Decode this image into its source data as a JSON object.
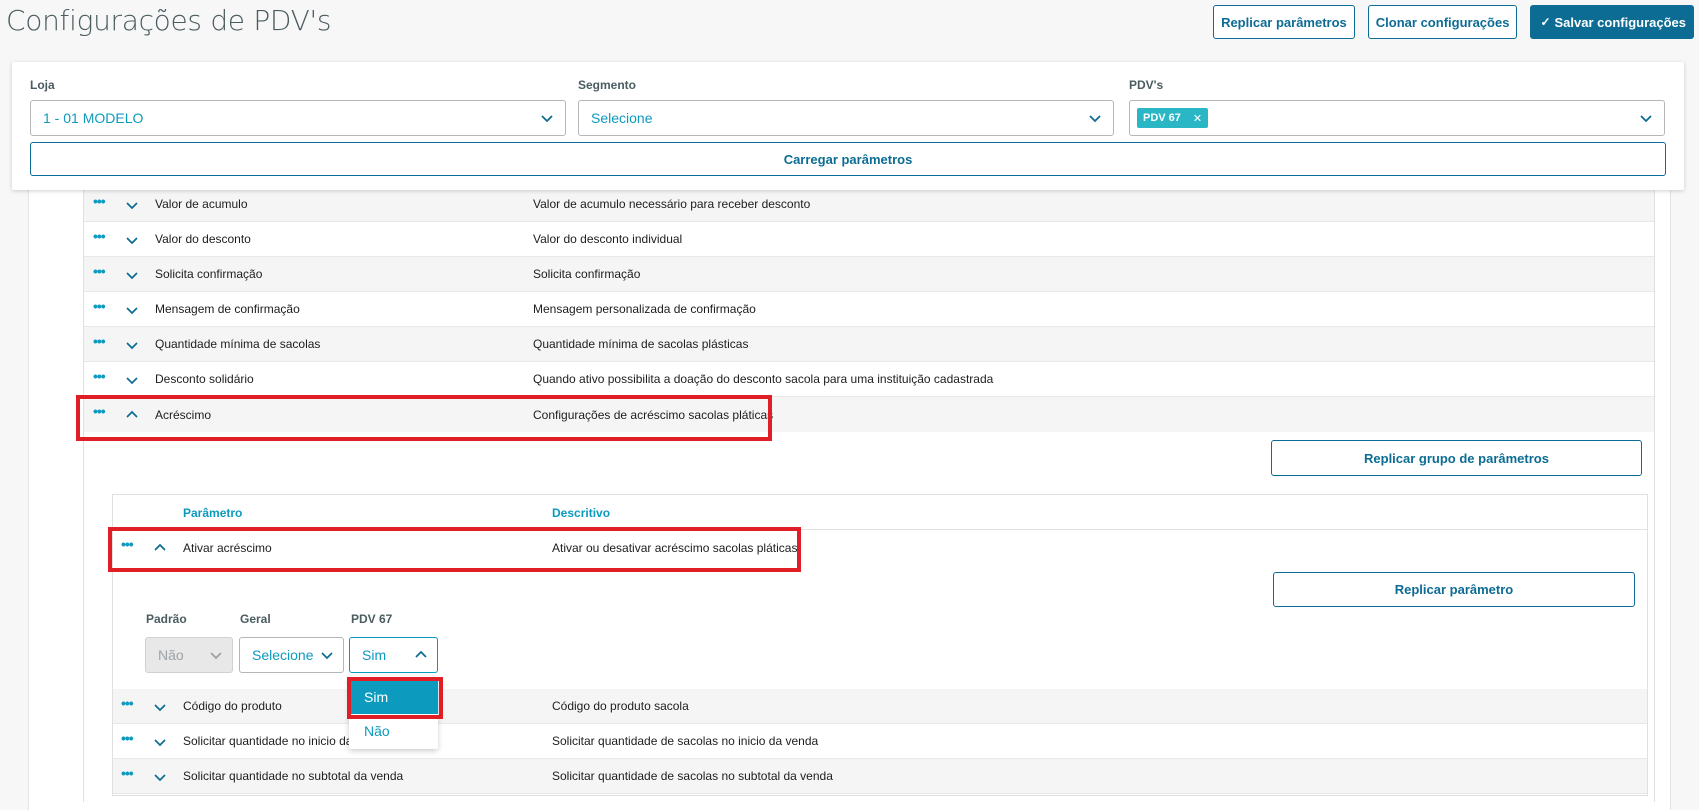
{
  "page": {
    "title": "Configurações de PDV's",
    "actions": {
      "replicate": "Replicar parâmetros",
      "clone": "Clonar configurações",
      "save": "Salvar configurações"
    }
  },
  "filters": {
    "loja": {
      "label": "Loja",
      "value": "1 - 01 MODELO"
    },
    "segmento": {
      "label": "Segmento",
      "value": "Selecione"
    },
    "pdvs": {
      "label": "PDV's",
      "tags": [
        "PDV 67"
      ]
    },
    "load_button": "Carregar parâmetros"
  },
  "outer_rows": [
    {
      "name": "Valor de acumulo",
      "desc": "Valor de acumulo necessário para receber desconto"
    },
    {
      "name": "Valor do desconto",
      "desc": "Valor do desconto individual"
    },
    {
      "name": "Solicita confirmação",
      "desc": "Solicita confirmação"
    },
    {
      "name": "Mensagem de confirmação",
      "desc": "Mensagem personalizada de confirmação"
    },
    {
      "name": "Quantidade mínima de sacolas",
      "desc": "Quantidade mínima de sacolas plásticas"
    },
    {
      "name": "Desconto solidário",
      "desc": "Quando ativo possibilita a doação do desconto sacola para uma instituição cadastrada"
    },
    {
      "name": "Acréscimo",
      "desc": "Configurações de acréscimo sacolas pláticas"
    }
  ],
  "group": {
    "replicate_group_button": "Replicar grupo de parâmetros",
    "headers": {
      "param": "Parâmetro",
      "desc": "Descritivo"
    },
    "expanded_row": {
      "name": "Ativar acréscimo",
      "desc": "Ativar ou desativar acréscimo sacolas pláticas"
    },
    "replicate_param_button": "Replicar parâmetro",
    "editor": {
      "padrao": {
        "label": "Padrão",
        "value": "Não"
      },
      "geral": {
        "label": "Geral",
        "value": "Selecione"
      },
      "pdv": {
        "label": "PDV 67",
        "value": "Sim"
      },
      "options": [
        "Sim",
        "Não"
      ]
    },
    "rows": [
      {
        "name": "Código do produto",
        "desc": "Código do produto sacola"
      },
      {
        "name": "Solicitar quantidade no inicio da venda",
        "desc": "Solicitar quantidade de sacolas no inicio da venda"
      },
      {
        "name": "Solicitar quantidade no subtotal da venda",
        "desc": "Solicitar quantidade de sacolas no subtotal da venda"
      }
    ]
  }
}
